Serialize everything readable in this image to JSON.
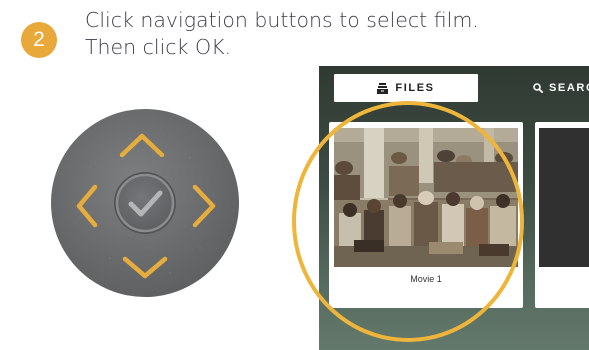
{
  "step": {
    "number": "2",
    "line1": "Click navigation buttons to select film.",
    "line2": "Then click OK."
  },
  "remote": {
    "buttons": [
      "up",
      "down",
      "left",
      "right",
      "ok"
    ],
    "arrow_color": "#e6ac3c",
    "body_color": "#6e7072"
  },
  "app": {
    "tabs": [
      {
        "label": "FILES",
        "icon": "file-stack-icon",
        "selected": true
      },
      {
        "label": "SEARC",
        "icon": "search-icon",
        "selected": false
      }
    ],
    "movies": [
      {
        "title": "Movie 1",
        "selected": true
      },
      {
        "title": "",
        "selected": false
      }
    ]
  },
  "colors": {
    "accent": "#efb53b",
    "badge": "#e8a83a",
    "text": "#3a3d42",
    "screen_bg": "#3c4b42"
  }
}
